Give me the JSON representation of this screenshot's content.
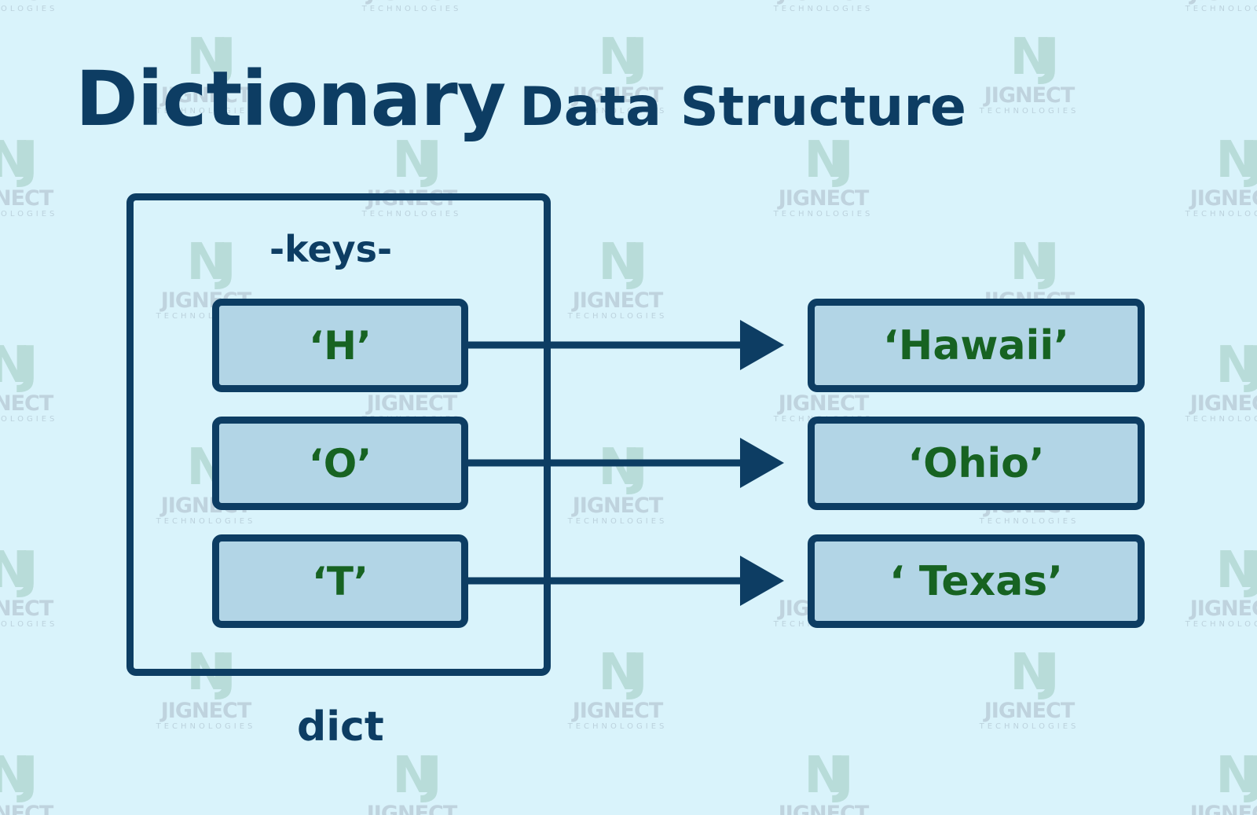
{
  "watermark": {
    "brand": "JIGNECT",
    "sub": "TECHNOLOGIES",
    "glyph": "NJ"
  },
  "title": {
    "main": "Dictionary",
    "sub": "Data Structure"
  },
  "dict": {
    "container_label": "dict",
    "keys_label": "-keys-",
    "pairs": [
      {
        "key": "‘H’",
        "value": "‘Hawaii’"
      },
      {
        "key": "‘O’",
        "value": "‘Ohio’"
      },
      {
        "key": "‘T’",
        "value": "‘ Texas’"
      }
    ]
  },
  "colors": {
    "background": "#d9f3fb",
    "outline": "#0d3d63",
    "cell_fill": "#b2d5e6",
    "cell_text": "#176322"
  }
}
